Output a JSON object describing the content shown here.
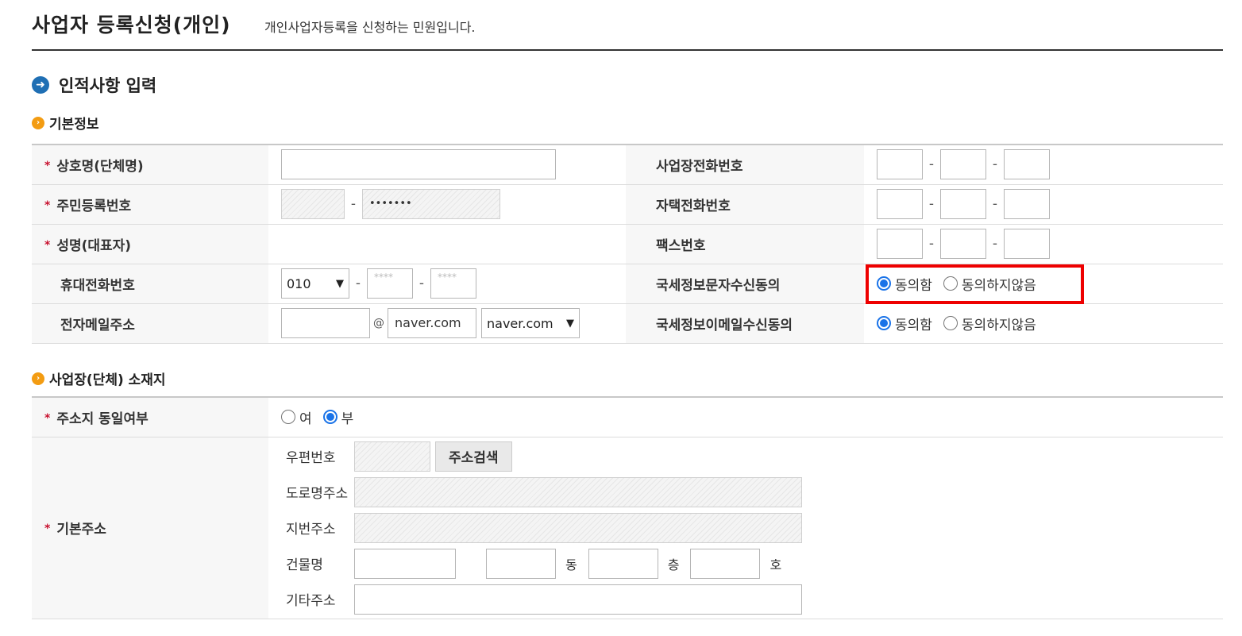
{
  "header": {
    "title": "사업자 등록신청(개인)",
    "desc": "개인사업자등록을 신청하는 민원입니다."
  },
  "section": {
    "title": "인적사항 입력"
  },
  "basic": {
    "title": "기본정보",
    "company_label": "상호명(단체명)",
    "rrn_label": "주민등록번호",
    "rrn_masked": "•••••••",
    "name_label": "성명(대표자)",
    "mobile_label": "휴대전화번호",
    "mobile_prefix": "010",
    "mobile_placeholder": "****",
    "email_label": "전자메일주소",
    "email_at": "@",
    "email_domain": "naver.com",
    "email_domain_select": "naver.com",
    "biz_phone_label": "사업장전화번호",
    "home_phone_label": "자택전화번호",
    "fax_label": "팩스번호",
    "sms_consent_label": "국세정보문자수신동의",
    "email_consent_label": "국세정보이메일수신동의",
    "agree": "동의함",
    "disagree": "동의하지않음",
    "dash": "-"
  },
  "location": {
    "title": "사업장(단체) 소재지",
    "same_label": "주소지 동일여부",
    "yes": "여",
    "no": "부",
    "addr_label": "기본주소",
    "zip_label": "우편번호",
    "search_btn": "주소검색",
    "road_label": "도로명주소",
    "lot_label": "지번주소",
    "building_label": "건물명",
    "dong": "동",
    "floor": "층",
    "ho": "호",
    "other_label": "기타주소"
  }
}
